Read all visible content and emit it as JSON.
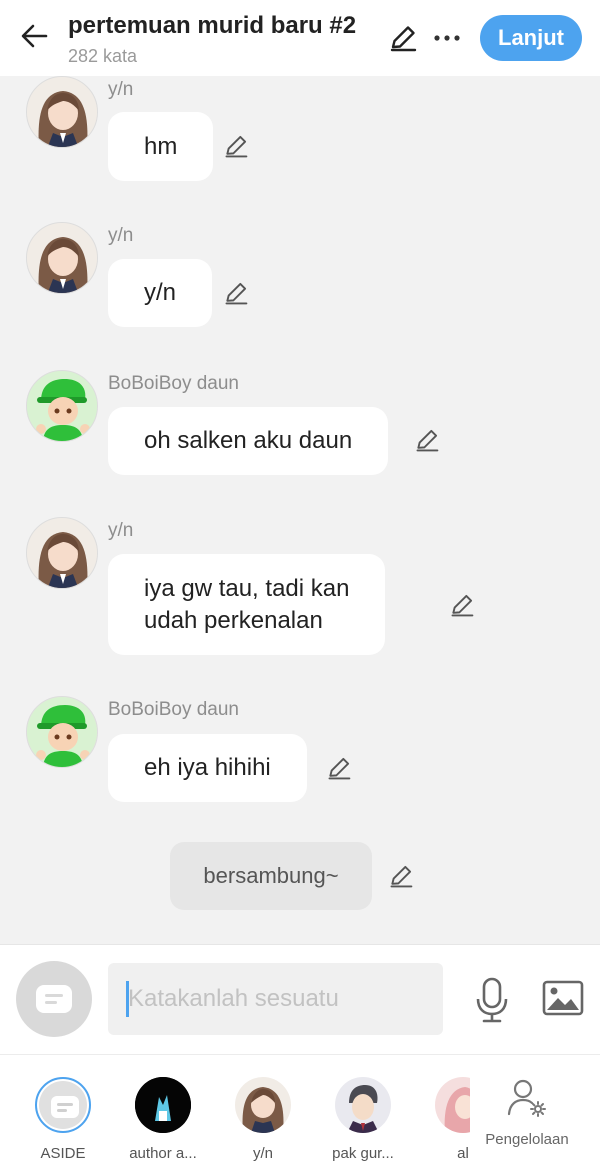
{
  "header": {
    "title": "pertemuan murid baru #2",
    "word_count": "282 kata",
    "next_label": "Lanjut"
  },
  "messages": [
    {
      "speaker": "y/n",
      "text": "hm"
    },
    {
      "speaker": "y/n",
      "text": "y/n"
    },
    {
      "speaker": "BoBoiBoy daun",
      "text": "oh salken aku daun"
    },
    {
      "speaker": "y/n",
      "line1": "iya gw tau, tadi kan",
      "line2": "udah perkenalan"
    },
    {
      "speaker": "BoBoiBoy daun",
      "text": "eh iya hihihi"
    }
  ],
  "narration": {
    "text": "bersambung~"
  },
  "input": {
    "placeholder": "Katakanlah sesuatu"
  },
  "characters": [
    {
      "name": "ASIDE"
    },
    {
      "name": "author a..."
    },
    {
      "name": "y/n"
    },
    {
      "name": "pak gur..."
    },
    {
      "name": "al"
    }
  ],
  "manage": {
    "label": "Pengelolaan"
  },
  "colors": {
    "accent": "#4da3ef",
    "background": "#f2f2f2",
    "bubble": "#ffffff"
  }
}
